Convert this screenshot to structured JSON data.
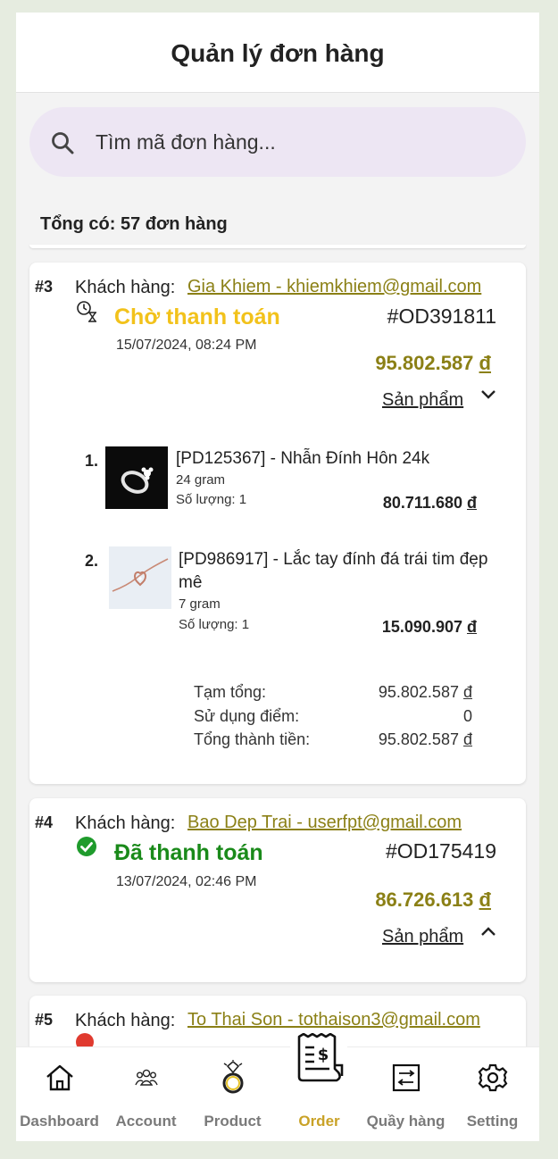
{
  "header": {
    "title": "Quản lý đơn hàng"
  },
  "search": {
    "placeholder": "Tìm mã đơn hàng..."
  },
  "summary": {
    "total_text": "Tổng có: 57 đơn hàng"
  },
  "currency_symbol": "đ",
  "colors": {
    "pending": "#f2c21b",
    "paid": "#1a8a1a",
    "gold": "#8b8016",
    "active_nav": "#c9a227"
  },
  "orders": [
    {
      "index": "#3",
      "customer_label": "Khách hàng:",
      "customer": "Gia Khiem - khiemkhiem@gmail.com",
      "status": "Chờ thanh toán",
      "status_icon": "hourglass-clock-icon",
      "code": "#OD391811",
      "date": "15/07/2024, 08:24 PM",
      "total": "95.802.587",
      "products_label": "Sản phẩm",
      "expanded": true,
      "items": [
        {
          "num": "1.",
          "name": "[PD125367] - Nhẫn Đính Hôn 24k",
          "weight": "24 gram",
          "qty": "Số lượng: 1",
          "price": "80.711.680"
        },
        {
          "num": "2.",
          "name": "[PD986917] - Lắc tay đính đá trái tim đẹp mê",
          "weight": "7 gram",
          "qty": "Số lượng: 1",
          "price": "15.090.907"
        }
      ],
      "summary": {
        "subtotal_label": "Tạm tổng:",
        "subtotal": "95.802.587",
        "points_label": "Sử dụng điểm:",
        "points": "0",
        "grand_label": "Tổng thành tiền:",
        "grand": "95.802.587"
      }
    },
    {
      "index": "#4",
      "customer_label": "Khách hàng:",
      "customer": "Bao Dep Trai - userfpt@gmail.com",
      "status": "Đã thanh toán",
      "status_icon": "check-circle-icon",
      "code": "#OD175419",
      "date": "13/07/2024, 02:46 PM",
      "total": "86.726.613",
      "products_label": "Sản phẩm",
      "expanded": false
    },
    {
      "index": "#5",
      "customer_label": "Khách hàng:",
      "customer": "To Thai Son - tothaison3@gmail.com"
    }
  ],
  "nav": [
    {
      "label": "Dashboard",
      "icon": "home-icon"
    },
    {
      "label": "Account",
      "icon": "users-icon"
    },
    {
      "label": "Product",
      "icon": "ring-icon"
    },
    {
      "label": "Order",
      "icon": "receipt-icon",
      "active": true
    },
    {
      "label": "Quầy hàng",
      "icon": "counter-icon"
    },
    {
      "label": "Setting",
      "icon": "gear-icon"
    }
  ]
}
